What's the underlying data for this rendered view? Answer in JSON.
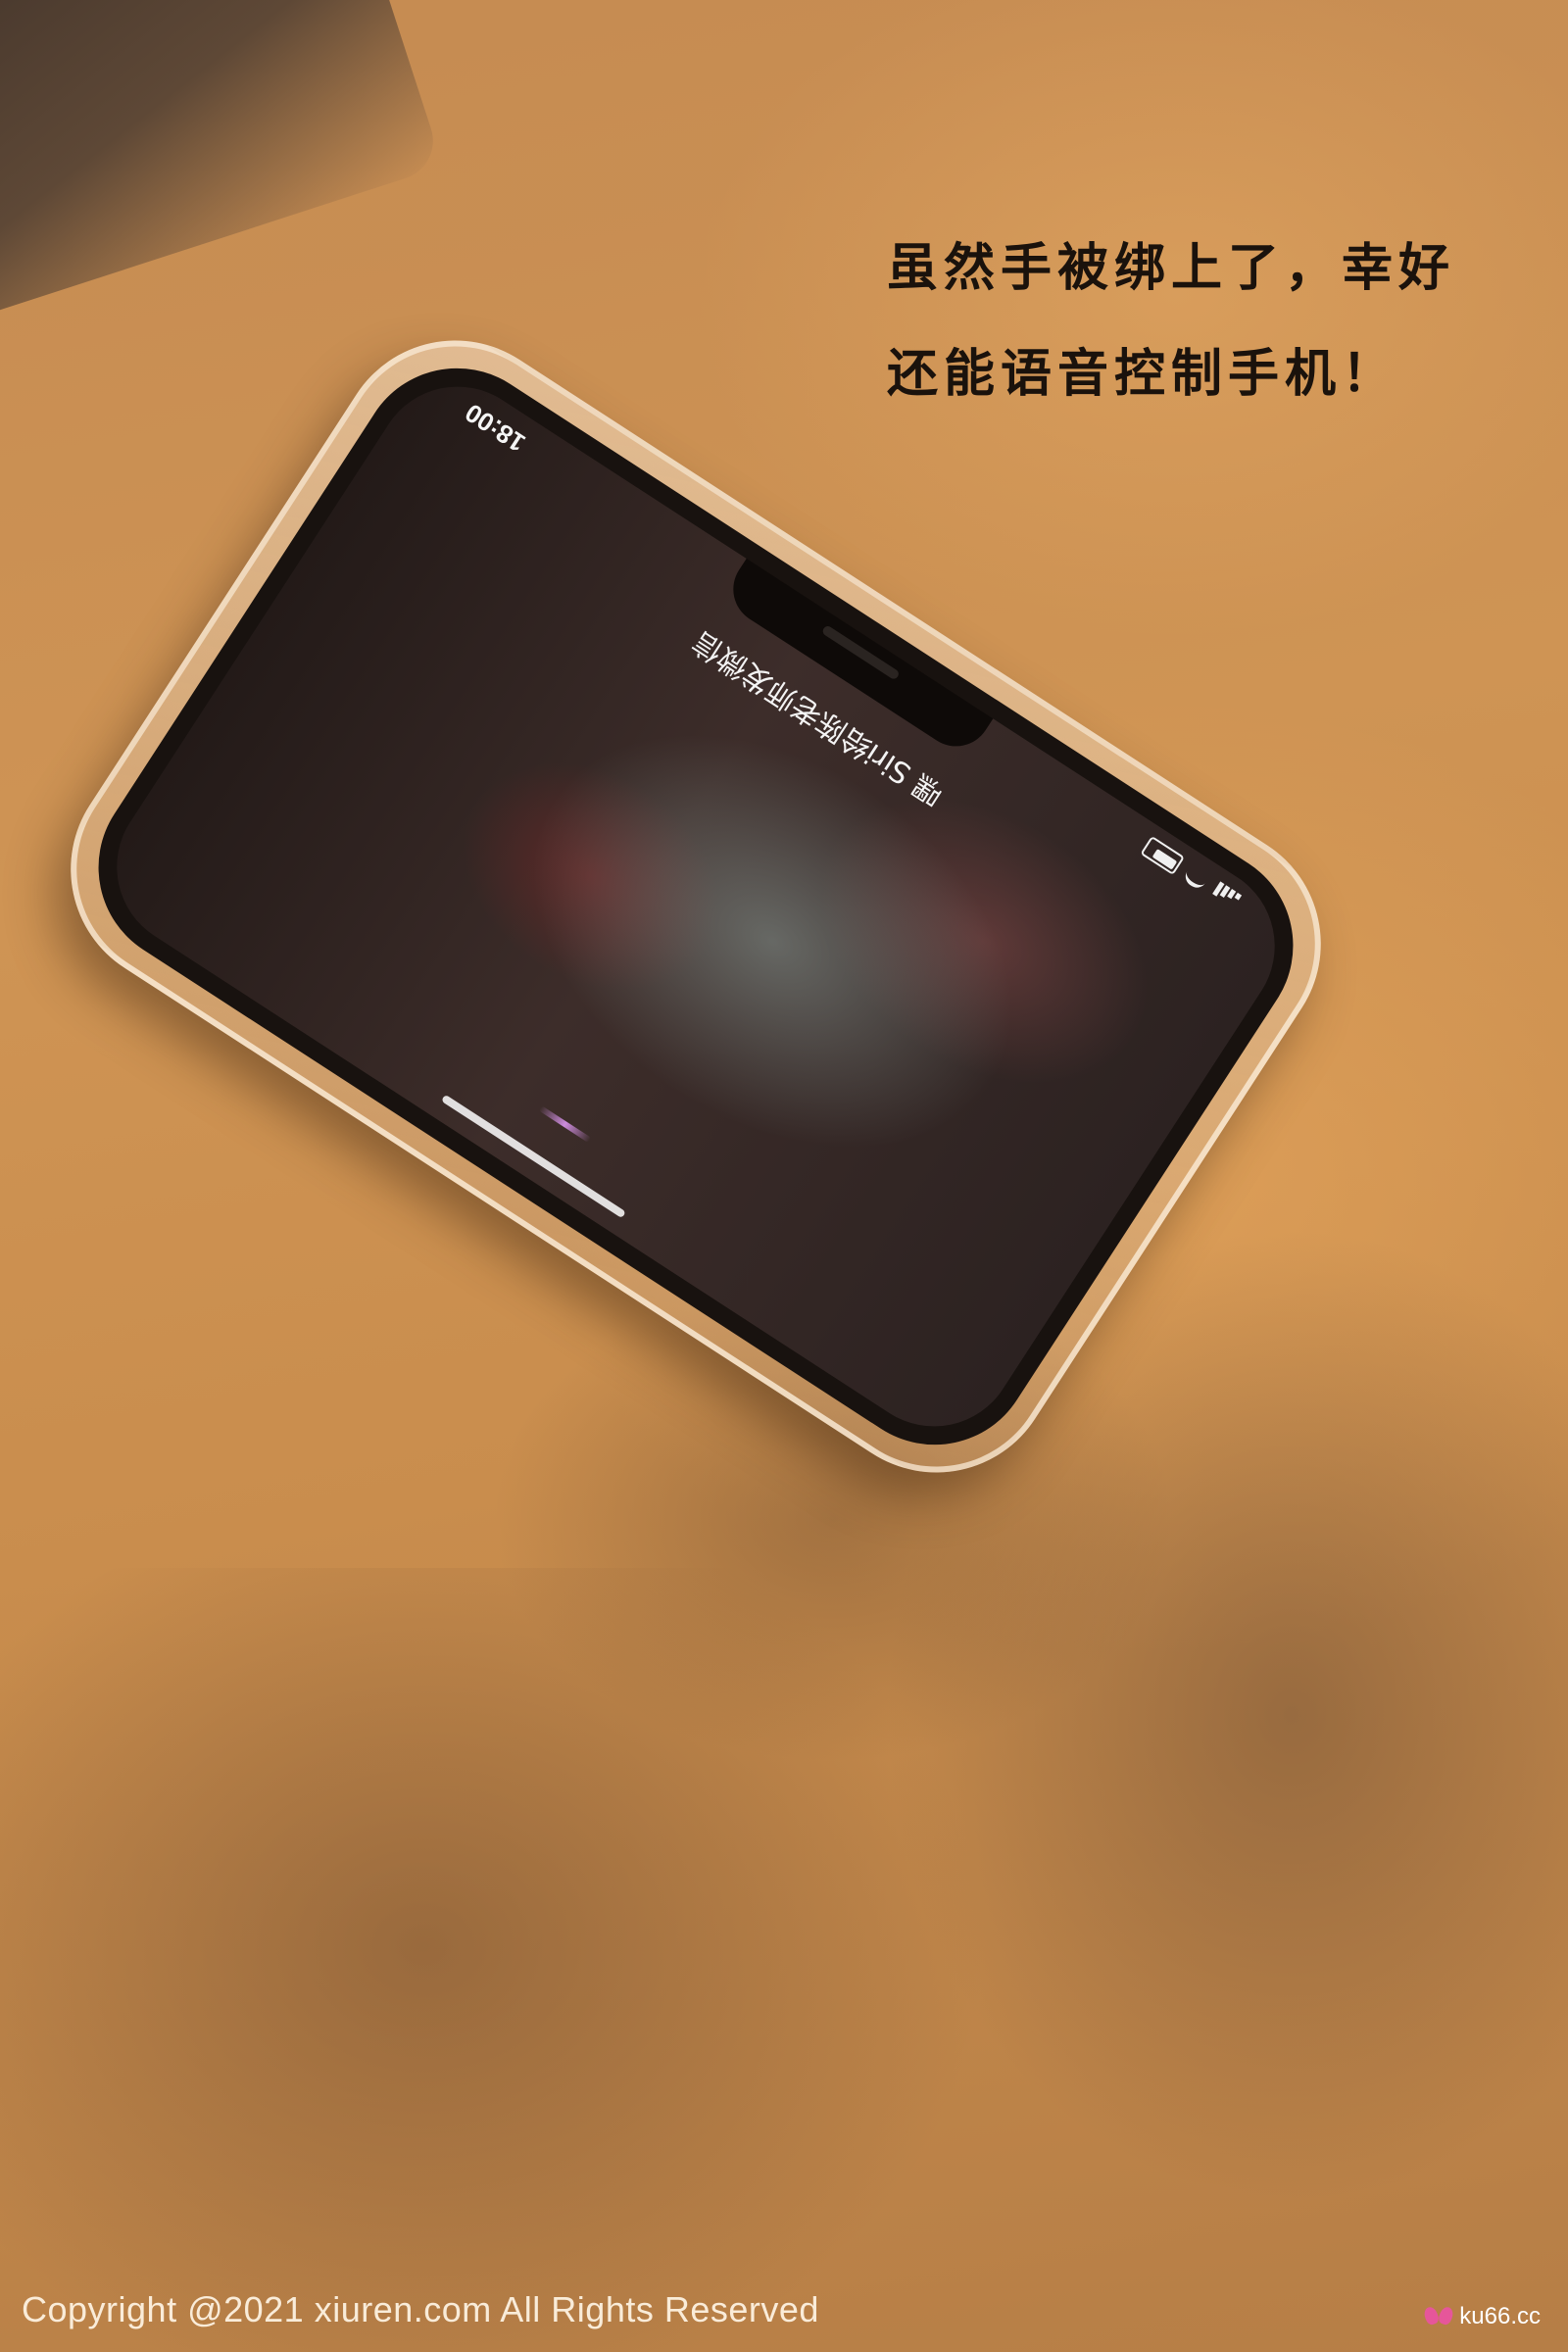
{
  "caption": {
    "line1": "虽然手被绑上了，幸好",
    "line2": "还能语音控制手机！"
  },
  "phone": {
    "status_time": "18:00",
    "siri_text": "嘿 Siri给陈老师发微信",
    "icons": [
      "signal-icon",
      "wifi-icon",
      "battery-icon"
    ]
  },
  "footer": {
    "copyright": "Copyright @2021  xiuren.com  All Rights Reserved",
    "watermark": "ku66.cc"
  }
}
